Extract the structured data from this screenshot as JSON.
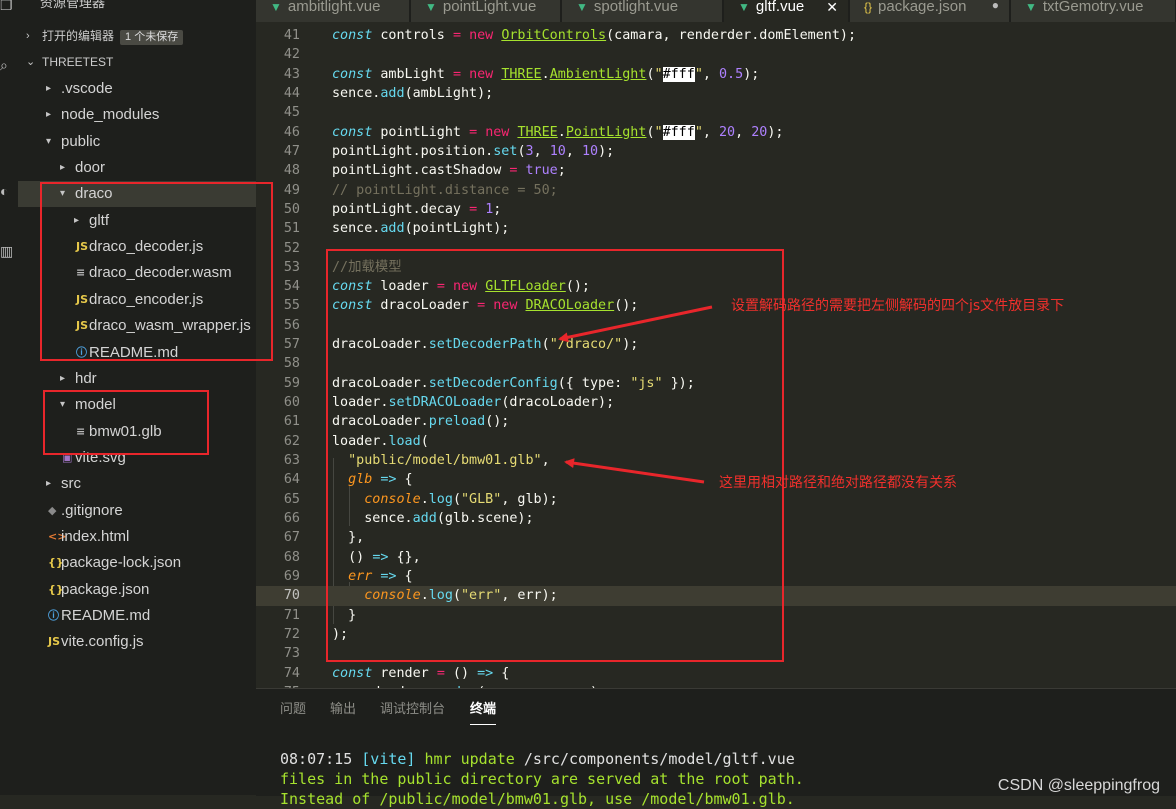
{
  "sidebar": {
    "title": "资源管理器",
    "open_editors": {
      "label": "打开的编辑器",
      "badge": "1 个未保存"
    },
    "project": {
      "label": "THREETEST"
    },
    "tree": [
      {
        "name": ".vscode",
        "kind": "folder",
        "expanded": false
      },
      {
        "name": "node_modules",
        "kind": "folder",
        "expanded": false
      },
      {
        "name": "public",
        "kind": "folder",
        "expanded": true
      },
      {
        "name": "door",
        "kind": "folder",
        "expanded": false
      },
      {
        "name": "draco",
        "kind": "folder",
        "expanded": true,
        "selected": true
      },
      {
        "name": "gltf",
        "kind": "folder",
        "expanded": false
      },
      {
        "name": "draco_decoder.js",
        "kind": "js",
        "icon": "JS"
      },
      {
        "name": "draco_decoder.wasm",
        "kind": "file",
        "icon": "≡"
      },
      {
        "name": "draco_encoder.js",
        "kind": "js",
        "icon": "JS"
      },
      {
        "name": "draco_wasm_wrapper.js",
        "kind": "js",
        "icon": "JS"
      },
      {
        "name": "README.md",
        "kind": "info",
        "icon": "ⓘ"
      },
      {
        "name": "hdr",
        "kind": "folder",
        "expanded": false
      },
      {
        "name": "model",
        "kind": "folder",
        "expanded": true
      },
      {
        "name": "bmw01.glb",
        "kind": "file",
        "icon": "≡"
      },
      {
        "name": "vite.svg",
        "kind": "svg",
        "icon": "▣"
      },
      {
        "name": "src",
        "kind": "folder",
        "expanded": false
      },
      {
        "name": ".gitignore",
        "kind": "git",
        "icon": "◆"
      },
      {
        "name": "index.html",
        "kind": "html",
        "icon": "<>"
      },
      {
        "name": "package-lock.json",
        "kind": "json",
        "icon": "{}"
      },
      {
        "name": "package.json",
        "kind": "json",
        "icon": "{}"
      },
      {
        "name": "README.md",
        "kind": "info",
        "icon": "ⓘ"
      },
      {
        "name": "vite.config.js",
        "kind": "js",
        "icon": "JS"
      }
    ]
  },
  "tabs": [
    {
      "label": "ambitlight.vue",
      "icon": "vue-icon"
    },
    {
      "label": "pointLight.vue",
      "icon": "vue-icon"
    },
    {
      "label": "spotlight.vue",
      "icon": "vue-icon"
    },
    {
      "label": "gltf.vue",
      "icon": "vue-icon",
      "active": true,
      "close": "✕"
    },
    {
      "label": "package.json",
      "icon": "json-icon",
      "unsaved": "●"
    },
    {
      "label": "txtGemotry.vue",
      "icon": "vue-icon"
    }
  ],
  "editor": {
    "current_line": 70,
    "lines": [
      {
        "n": 41,
        "t": [
          [
            "k",
            "const"
          ],
          [
            "",
            " controls "
          ],
          [
            "o",
            "="
          ],
          [
            "",
            " "
          ],
          [
            "o",
            "new"
          ],
          [
            "",
            " "
          ],
          [
            "f",
            "OrbitControls"
          ],
          [
            "",
            "(camara, renderder.domElement);"
          ]
        ]
      },
      {
        "n": 42,
        "t": []
      },
      {
        "n": 43,
        "t": [
          [
            "k",
            "const"
          ],
          [
            "",
            " ambLight "
          ],
          [
            "o",
            "="
          ],
          [
            "",
            " "
          ],
          [
            "o",
            "new"
          ],
          [
            "",
            " "
          ],
          [
            "f",
            "THREE"
          ],
          [
            "",
            "."
          ],
          [
            "f",
            "AmbientLight"
          ],
          [
            "",
            "("
          ],
          [
            "s",
            "\""
          ],
          [
            "hl",
            "#fff"
          ],
          [
            "s",
            "\""
          ],
          [
            "",
            ", "
          ],
          [
            "n",
            "0.5"
          ],
          [
            "",
            ");"
          ]
        ]
      },
      {
        "n": 44,
        "t": [
          [
            "",
            "sence."
          ],
          [
            "fn",
            "add"
          ],
          [
            "",
            "(ambLight);"
          ]
        ]
      },
      {
        "n": 45,
        "t": []
      },
      {
        "n": 46,
        "t": [
          [
            "k",
            "const"
          ],
          [
            "",
            " pointLight "
          ],
          [
            "o",
            "="
          ],
          [
            "",
            " "
          ],
          [
            "o",
            "new"
          ],
          [
            "",
            " "
          ],
          [
            "f",
            "THREE"
          ],
          [
            "",
            "."
          ],
          [
            "f",
            "PointLight"
          ],
          [
            "",
            "("
          ],
          [
            "s",
            "\""
          ],
          [
            "hl",
            "#fff"
          ],
          [
            "s",
            "\""
          ],
          [
            "",
            ", "
          ],
          [
            "n",
            "20"
          ],
          [
            "",
            ", "
          ],
          [
            "n",
            "20"
          ],
          [
            "",
            ");"
          ]
        ]
      },
      {
        "n": 47,
        "t": [
          [
            "",
            "pointLight.position."
          ],
          [
            "fn",
            "set"
          ],
          [
            "",
            "("
          ],
          [
            "n",
            "3"
          ],
          [
            "",
            ", "
          ],
          [
            "n",
            "10"
          ],
          [
            "",
            ", "
          ],
          [
            "n",
            "10"
          ],
          [
            "",
            ");"
          ]
        ]
      },
      {
        "n": 48,
        "t": [
          [
            "",
            "pointLight.castShadow "
          ],
          [
            "o",
            "="
          ],
          [
            "",
            " "
          ],
          [
            "n",
            "true"
          ],
          [
            "",
            ";"
          ]
        ]
      },
      {
        "n": 49,
        "t": [
          [
            "c",
            "// pointLight.distance = 50;"
          ]
        ]
      },
      {
        "n": 50,
        "t": [
          [
            "",
            "pointLight.decay "
          ],
          [
            "o",
            "="
          ],
          [
            "",
            " "
          ],
          [
            "n",
            "1"
          ],
          [
            "",
            ";"
          ]
        ]
      },
      {
        "n": 51,
        "t": [
          [
            "",
            "sence."
          ],
          [
            "fn",
            "add"
          ],
          [
            "",
            "(pointLight);"
          ]
        ]
      },
      {
        "n": 52,
        "t": []
      },
      {
        "n": 53,
        "t": [
          [
            "c",
            "//加载模型"
          ]
        ]
      },
      {
        "n": 54,
        "t": [
          [
            "k",
            "const"
          ],
          [
            "",
            " loader "
          ],
          [
            "o",
            "="
          ],
          [
            "",
            " "
          ],
          [
            "o",
            "new"
          ],
          [
            "",
            " "
          ],
          [
            "f",
            "GLTFLoader"
          ],
          [
            "",
            "();"
          ]
        ]
      },
      {
        "n": 55,
        "t": [
          [
            "k",
            "const"
          ],
          [
            "",
            " dracoLoader "
          ],
          [
            "o",
            "="
          ],
          [
            "",
            " "
          ],
          [
            "o",
            "new"
          ],
          [
            "",
            " "
          ],
          [
            "f",
            "DRACOLoader"
          ],
          [
            "",
            "();"
          ]
        ]
      },
      {
        "n": 56,
        "t": []
      },
      {
        "n": 57,
        "t": [
          [
            "",
            "dracoLoader."
          ],
          [
            "fn",
            "setDecoderPath"
          ],
          [
            "",
            "("
          ],
          [
            "s",
            "\"/draco/\""
          ],
          [
            "",
            ");"
          ]
        ]
      },
      {
        "n": 58,
        "t": []
      },
      {
        "n": 59,
        "t": [
          [
            "",
            "dracoLoader."
          ],
          [
            "fn",
            "setDecoderConfig"
          ],
          [
            "",
            "({ type: "
          ],
          [
            "s",
            "\"js\""
          ],
          [
            "",
            " });"
          ]
        ]
      },
      {
        "n": 60,
        "t": [
          [
            "",
            "loader."
          ],
          [
            "fn",
            "setDRACOLoader"
          ],
          [
            "",
            "(dracoLoader);"
          ]
        ]
      },
      {
        "n": 61,
        "t": [
          [
            "",
            "dracoLoader."
          ],
          [
            "fn",
            "preload"
          ],
          [
            "",
            "();"
          ]
        ]
      },
      {
        "n": 62,
        "t": [
          [
            "",
            "loader."
          ],
          [
            "fn",
            "load"
          ],
          [
            "",
            "("
          ]
        ]
      },
      {
        "n": 63,
        "t": [
          [
            "",
            "  "
          ],
          [
            "s",
            "\"public/model/bmw01.glb\""
          ],
          [
            "",
            ","
          ]
        ]
      },
      {
        "n": 64,
        "t": [
          [
            "",
            "  "
          ],
          [
            "p",
            "glb"
          ],
          [
            "",
            " "
          ],
          [
            "fn",
            "=>"
          ],
          [
            "",
            " {"
          ]
        ]
      },
      {
        "n": 65,
        "t": [
          [
            "",
            "    "
          ],
          [
            "p",
            "console"
          ],
          [
            "",
            "."
          ],
          [
            "fn",
            "log"
          ],
          [
            "",
            "("
          ],
          [
            "s",
            "\"GLB\""
          ],
          [
            "",
            ", glb);"
          ]
        ]
      },
      {
        "n": 66,
        "t": [
          [
            "",
            "    sence."
          ],
          [
            "fn",
            "add"
          ],
          [
            "",
            "(glb.scene);"
          ]
        ]
      },
      {
        "n": 67,
        "t": [
          [
            "",
            "  },"
          ]
        ]
      },
      {
        "n": 68,
        "t": [
          [
            "",
            "  () "
          ],
          [
            "fn",
            "=>"
          ],
          [
            "",
            " {},"
          ]
        ]
      },
      {
        "n": 69,
        "t": [
          [
            "",
            "  "
          ],
          [
            "p",
            "err"
          ],
          [
            "",
            " "
          ],
          [
            "fn",
            "=>"
          ],
          [
            "",
            " {"
          ]
        ]
      },
      {
        "n": 70,
        "t": [
          [
            "",
            "    "
          ],
          [
            "p",
            "console"
          ],
          [
            "",
            "."
          ],
          [
            "fn",
            "log"
          ],
          [
            "",
            "("
          ],
          [
            "s",
            "\"err\""
          ],
          [
            "",
            ", err);"
          ]
        ]
      },
      {
        "n": 71,
        "t": [
          [
            "",
            "  }"
          ]
        ]
      },
      {
        "n": 72,
        "t": [
          [
            "",
            ");"
          ]
        ]
      },
      {
        "n": 73,
        "t": []
      },
      {
        "n": 74,
        "t": [
          [
            "k",
            "const"
          ],
          [
            "",
            " render "
          ],
          [
            "o",
            "="
          ],
          [
            "",
            " () "
          ],
          [
            "fn",
            "=>"
          ],
          [
            "",
            " {"
          ]
        ]
      },
      {
        "n": 75,
        "t": [
          [
            "",
            "  renderder."
          ],
          [
            "fn",
            "render"
          ],
          [
            "",
            "(sence, camera);"
          ]
        ]
      }
    ]
  },
  "annotations": {
    "note_decoder_path": "设置解码路径的需要把左侧解码的四个js文件放目录下",
    "note_relative_path": "这里用相对路径和绝对路径都没有关系"
  },
  "panel": {
    "tabs": [
      "问题",
      "输出",
      "调试控制台",
      "终端"
    ],
    "active_tab": "终端",
    "terminal": {
      "line1": {
        "time": "08:07:15",
        "tag": "[vite]",
        "msg": "hmr update",
        "path": "/src/components/model/gltf.vue"
      },
      "line2": "files in the public directory are served at the root path.",
      "line3": "Instead of /public/model/bmw01.glb, use /model/bmw01.glb."
    }
  },
  "watermark": "CSDN @sleeppingfrog",
  "colors": {
    "accent": "#41b883",
    "annotation": "#e8262b",
    "editor_bg": "#272822",
    "sidebar_bg": "#1e1f1c"
  }
}
